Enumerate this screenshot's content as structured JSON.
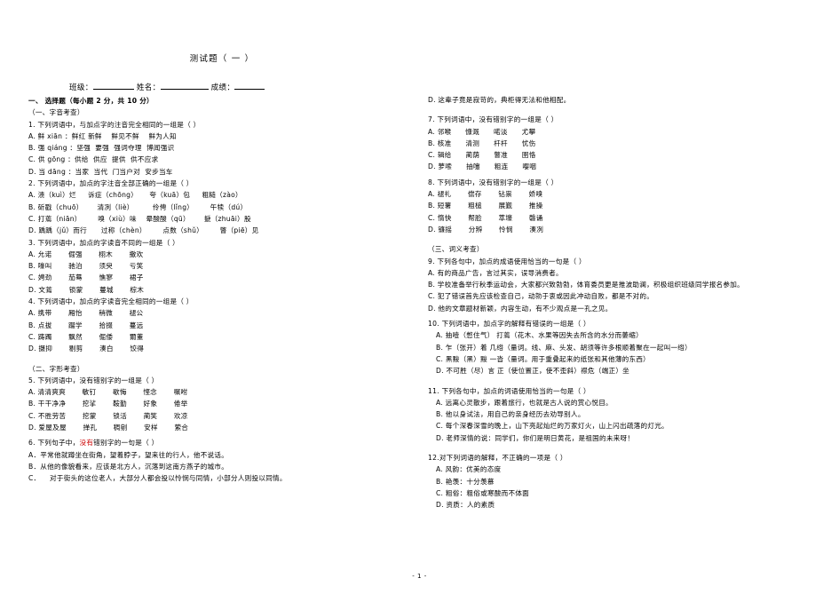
{
  "document": {
    "title": "测试题（ 一 ）",
    "id_line": {
      "class_label": "班级：",
      "name_label": "姓名：",
      "score_label": "成绩："
    },
    "page_number": "- 1 -"
  },
  "left_column": {
    "section_1_head": "一、        选择题（每小题 2 分，共 10 分）",
    "subsection_1": "（一、字音考查）",
    "q1": {
      "stem": "1. 下列词语中，与加点字的注音完全相同的一组是（        ）",
      "options": [
        "A. 鲜 xiān ：鲜红 新鲜    鲜见不鲜    鲜为人知",
        "B. 强 qiáng ：坚强  要强  强词夺理  博闻强识",
        "C. 供 gōng ：供给  供应  提供  供不应求",
        "D. 当 dāng ：当家  当代  门当户对  安步当车"
      ]
    },
    "q2": {
      "stem": "2. 下列词语中，加点的字注音全部正确的一组是（        ）",
      "options": [
        "A. 溃（kuì）烂     诉症（chōng）     夸（kuā）包     粗糙（zào）",
        "B. 斫戳（chuō）      清冽（liè）        伶俜（lǐng）       午犊（dú）",
        "C. 打蔫（niān）       嗅（xiù）味    晕酸酸（qū）      搋（zhuāi）股",
        "D. 踽踽（jǔ）而行      过称（chèn）       点数（shǔ）       瞥（piē）见"
      ]
    },
    "q3": {
      "stem": "3. 下列词语中，加点的字读音不同的一组是（        ）",
      "options": [
        "A. 允诺       倔强       栩木       撒欢",
        "B. 嚎叫       驰泊       须臾       亏笑",
        "C. 娉劲       茄蓦       憔寥       裙子",
        "D. 文蔫       锁蒙       蔓城       棕木"
      ]
    },
    "q4": {
      "stem": "4. 下列词语中，加点的字读音完全相同的一组是（        ）",
      "options": [
        "A. 携带       厢怡       稍微       褪公",
        "B. 点拔       蹑学       拾掇       蔓远",
        "C. 踌躅       飘然       倔倭       爾董",
        "D. 摄抑       剔剪       湊白       饺得"
      ]
    },
    "subsection_2": "（二、字形考查）",
    "q5": {
      "stem_pre": "5. 下列词语中，没有错别字的一组是（        ）",
      "options": [
        "A. 清清爽爽       敏钉       歇悔       悭念       嘱咐",
        "B. 干干净净       挖挲       鞍勤       好象       倦举",
        "C. 不胜劳苦       挖蒙       锁活       蔺笑       欢凉",
        "D. 爱屋及屋       掸孔       稠剜       安样       萦合"
      ],
      "red_char": "样"
    },
    "q6": {
      "stem_pre": "6. 下列句子中，",
      "stem_red": "没有",
      "stem_post": "错别字的一句是（      ）",
      "options": [
        "A．平常他就蹲坐在街角，望着脖子，望来往的行人，他不说话。",
        "B．从他的像貌看来，应该是北方人，沉落到这南方燕子的城市。",
        "C．    对于街头的这位老人，大部分人都会投以怜悯与同情，小部分人则投以同情。"
      ]
    }
  },
  "right_column": {
    "q6_tail": "D. 这辈子竟是寂苛的，典柜得无法和他相配。",
    "q7": {
      "stem": "7. 下列词语中，没有错别字的一组是（        ）",
      "options": [
        "A. 邻喉      慷溉      喏淡      尤攀",
        "B. 核准      清测      杆杆      忧伤",
        "C. 辑给      蔺荫      瞥准      圉恪",
        "D. 萝嗦      抽嚏      粗连      嘤咽"
      ]
    },
    "q8": {
      "stem": "8. 下列词语中，没有错别字的一组是（        ）",
      "options": [
        "A. 褪礼       偿存       钻祟       娇嗅",
        "B. 短薯       粗槌       展觐       推操",
        "C. 惰快       帮脸       萃壕       磬诵",
        "D. 镰摇       分辨       怜悯       湊冽"
      ]
    },
    "subsection_3": "（三、词义考查）",
    "q9": {
      "stem": "9. 下列各句中，加点的成语使用恰当的一句是（        ）",
      "options": [
        "A. 有的商品广告，言过其实，误导消费者。",
        "B. 学校准备举行秋季运动会，大家都兴致勃勃，体育委员更是推波助澜，积极组织班级同学报名参加。",
        "C. 犯了错误首先应该检查自己，动勍于衷或因此冲动自败，都是不对的。",
        "D. 他的文章题材新颖，内容生动，有不少观点是一孔之见。"
      ]
    },
    "q10": {
      "stem": "10. 下列词语中，加点字的解释有错误的一组是（        ）",
      "options": [
        "A.  抽噎（憋住气）    打蔫（花木、水果等因失去所含的水分而萎缩）",
        "B.  乍（张开）着    几绺（量词。线、麻、头发、胡须等许多根顺着聚在一起叫一绺）",
        "C.  黑黢（黑）黢    一沓（量词。用于重叠起来的纸张和其他薄的东西）",
        "D.  不可胜（尽）言     正（使位置正，使不歪斜）襟危（端正）坐"
      ]
    },
    "q11": {
      "stem": "11. 下列各句中，加点的词语使用恰当的一句是（        ）",
      "options": [
        "A. 远离心灵散步，跟着旅行，也就是古人说的赏心悦目。",
        "B. 他以身试法，用自己的亲身经历去劝导别人。",
        "C. 每个深春深雪的晚上，山下亮起灿烂的万家灯火，山上闪出疏落的灯光。",
        "D. 老师深情的说：同学们，你们是明日黄花，是祖国的未来呀！"
      ]
    },
    "q12": {
      "stem": "12.对下列词语的解释，不正确的一项是（        ）",
      "options": [
        "A. 风韵：优美的态度",
        "B. 艳羡：十分羡慕",
        "C. 粗俗：粗俗或寒酸而不体面",
        "D. 资质：人的素质"
      ]
    }
  }
}
